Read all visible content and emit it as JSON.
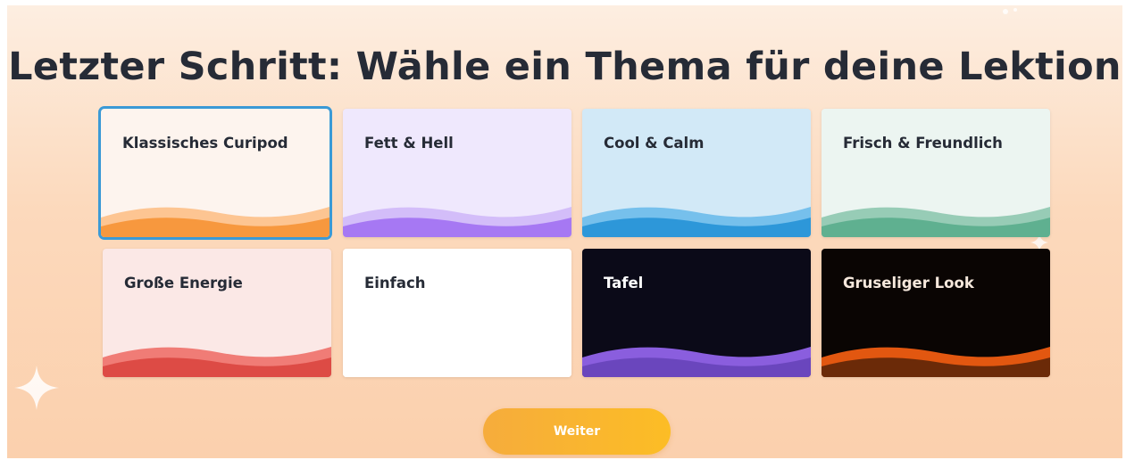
{
  "page": {
    "title": "Letzter Schritt: Wähle ein Thema für deine Lektion"
  },
  "themes": [
    {
      "label": "Klassisches Curipod",
      "selected": true,
      "bg": "#fdf4ee",
      "text": "#262b36",
      "wave_back": "#fdc592",
      "wave_front": "#f7983e"
    },
    {
      "label": "Fett & Hell",
      "selected": false,
      "bg": "#efe8fd",
      "text": "#262b36",
      "wave_back": "#d3bdf9",
      "wave_front": "#a678f3"
    },
    {
      "label": "Cool & Calm",
      "selected": false,
      "bg": "#d2e9f7",
      "text": "#262b36",
      "wave_back": "#76c0ec",
      "wave_front": "#2d97d9"
    },
    {
      "label": "Frisch & Freundlich",
      "selected": false,
      "bg": "#ecf5f1",
      "text": "#262b36",
      "wave_back": "#97ccb6",
      "wave_front": "#5fb090"
    },
    {
      "label": "Große Energie",
      "selected": false,
      "bg": "#fbe8e6",
      "text": "#262b36",
      "wave_back": "#f07c76",
      "wave_front": "#dd4b45"
    },
    {
      "label": "Einfach",
      "selected": false,
      "bg": "#ffffff",
      "text": "#262b36",
      "wave_back": "#ffffff",
      "wave_front": "#ffffff"
    },
    {
      "label": "Tafel",
      "selected": false,
      "bg": "#0b0a18",
      "text": "#ffffff",
      "wave_back": "#8a5ede",
      "wave_front": "#6a46bd"
    },
    {
      "label": "Gruseliger Look",
      "selected": false,
      "bg": "#0a0503",
      "text": "#f6e8dc",
      "wave_back": "#e25710",
      "wave_front": "#6b2a08"
    }
  ],
  "actions": {
    "next_label": "Weiter"
  },
  "colors": {
    "accent": "#fcb52c",
    "selection": "#3b9ad6"
  }
}
